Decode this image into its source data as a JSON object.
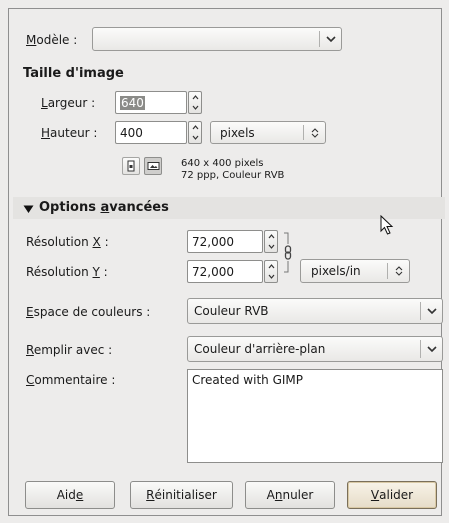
{
  "template": {
    "label": "Modèle :",
    "label_u": "M",
    "label_rest": "odèle :",
    "value": ""
  },
  "image_size": {
    "title": "Taille d'image",
    "width": {
      "label_u": "L",
      "label_rest": "argeur :",
      "value": "640"
    },
    "height": {
      "label_u": "H",
      "label_rest": "auteur :",
      "value": "400"
    },
    "unit": "pixels",
    "info_line1": "640 x 400 pixels",
    "info_line2": "72 ppp, Couleur RVB"
  },
  "advanced": {
    "title_pre": "Options ",
    "title_u": "a",
    "title_post": "vancées",
    "res_x": {
      "label_pre": "Résolution ",
      "label_u": "X",
      "label_post": " :",
      "value": "72,000"
    },
    "res_y": {
      "label_pre": "Résolution ",
      "label_u": "Y",
      "label_post": " :",
      "value": "72,000"
    },
    "res_unit": "pixels/in",
    "colorspace": {
      "label_u": "E",
      "label_rest": "space de couleurs :",
      "value": "Couleur RVB"
    },
    "fill": {
      "label_u": "R",
      "label_rest": "emplir avec :",
      "value": "Couleur d'arrière-plan"
    },
    "comment": {
      "label_u": "C",
      "label_rest": "ommentaire :",
      "value": "Created with GIMP"
    }
  },
  "buttons": {
    "help": {
      "pre": "Aid",
      "u": "e",
      "post": ""
    },
    "reset": {
      "pre": "",
      "u": "R",
      "post": "éinitialiser"
    },
    "cancel": {
      "pre": "A",
      "u": "n",
      "post": "nuler"
    },
    "ok": {
      "pre": "",
      "u": "V",
      "post": "alider"
    }
  },
  "colors": {
    "background": "#edeceb",
    "selection": "#8b8b88",
    "default_button": "#e6dcc8"
  },
  "icons": [
    "chevron-down-icon",
    "spin-up-icon",
    "spin-down-icon",
    "portrait-icon",
    "landscape-icon",
    "disclosure-triangle-icon",
    "chain-link-icon",
    "mouse-pointer-icon"
  ]
}
